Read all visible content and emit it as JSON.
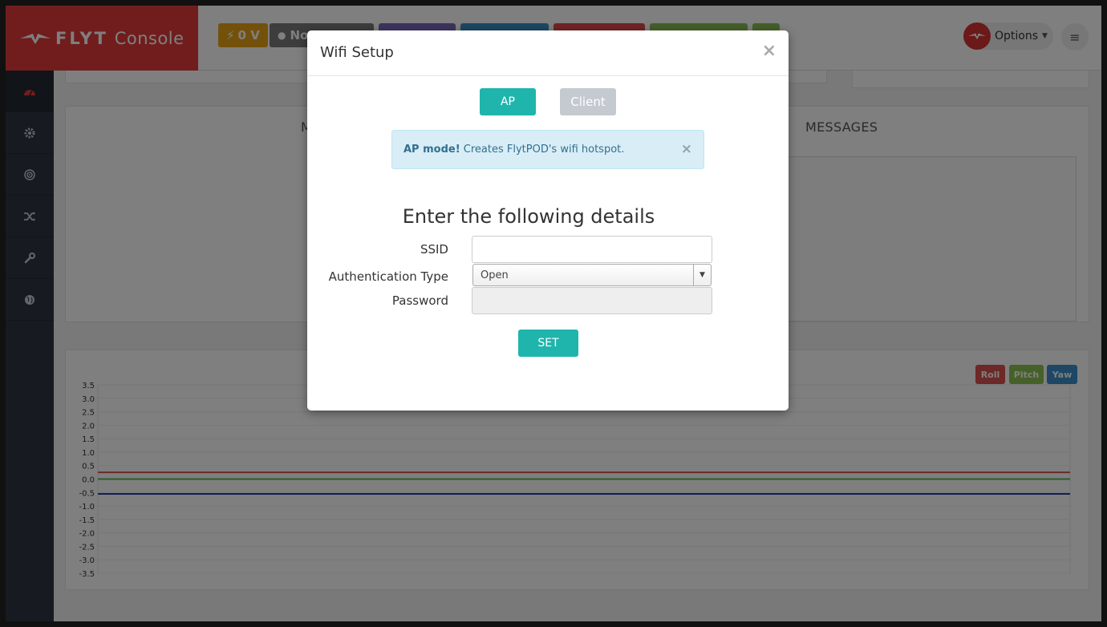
{
  "app": {
    "brand_strong": "FLYT",
    "brand_light": "Console"
  },
  "header": {
    "voltage_badge": "0 V",
    "location_badge": "No",
    "options_label": "Options"
  },
  "colors": {
    "brand_red": "#e23a3a",
    "accent_teal": "#1fb5ad",
    "client_gray": "#c5c9d0",
    "roll": "#d9534f",
    "pitch": "#8cc152",
    "yaw": "#3a8ec8"
  },
  "sidebar": {
    "items": [
      {
        "icon": "dashboard-icon",
        "active": true
      },
      {
        "icon": "gear-icon"
      },
      {
        "icon": "target-icon"
      },
      {
        "icon": "shuffle-icon"
      },
      {
        "icon": "wrench-icon"
      },
      {
        "icon": "globe-icon"
      }
    ]
  },
  "panels": {
    "messages_title": "MESSAGES",
    "top_left_partial": "M"
  },
  "legend": {
    "roll": "Roll",
    "pitch": "Pitch",
    "yaw": "Yaw"
  },
  "chart_data": {
    "type": "line",
    "ylim": [
      -3.5,
      3.5
    ],
    "yticks": [
      "3.5",
      "3.0",
      "2.5",
      "2.0",
      "1.5",
      "1.0",
      "0.5",
      "0.0",
      "-0.5",
      "-1.0",
      "-1.5",
      "-2.0",
      "-2.5",
      "-3.0",
      "-3.5"
    ],
    "series": [
      {
        "name": "Roll",
        "color": "#d9534f",
        "value": 0.25
      },
      {
        "name": "Pitch",
        "color": "#5cb85c",
        "value": 0.0
      },
      {
        "name": "Yaw",
        "color": "#1f3fa8",
        "value": -0.55
      }
    ]
  },
  "modal": {
    "title": "Wifi Setup",
    "close": "×",
    "ap_label": "AP",
    "client_label": "Client",
    "alert_strong": "AP mode!",
    "alert_text": " Creates FlytPOD's wifi hotspot.",
    "alert_close": "×",
    "details_title": "Enter the following details",
    "ssid_label": "SSID",
    "ssid_value": "",
    "auth_label": "Authentication Type",
    "auth_selected": "Open",
    "password_label": "Password",
    "password_value": "",
    "set_label": "SET"
  }
}
